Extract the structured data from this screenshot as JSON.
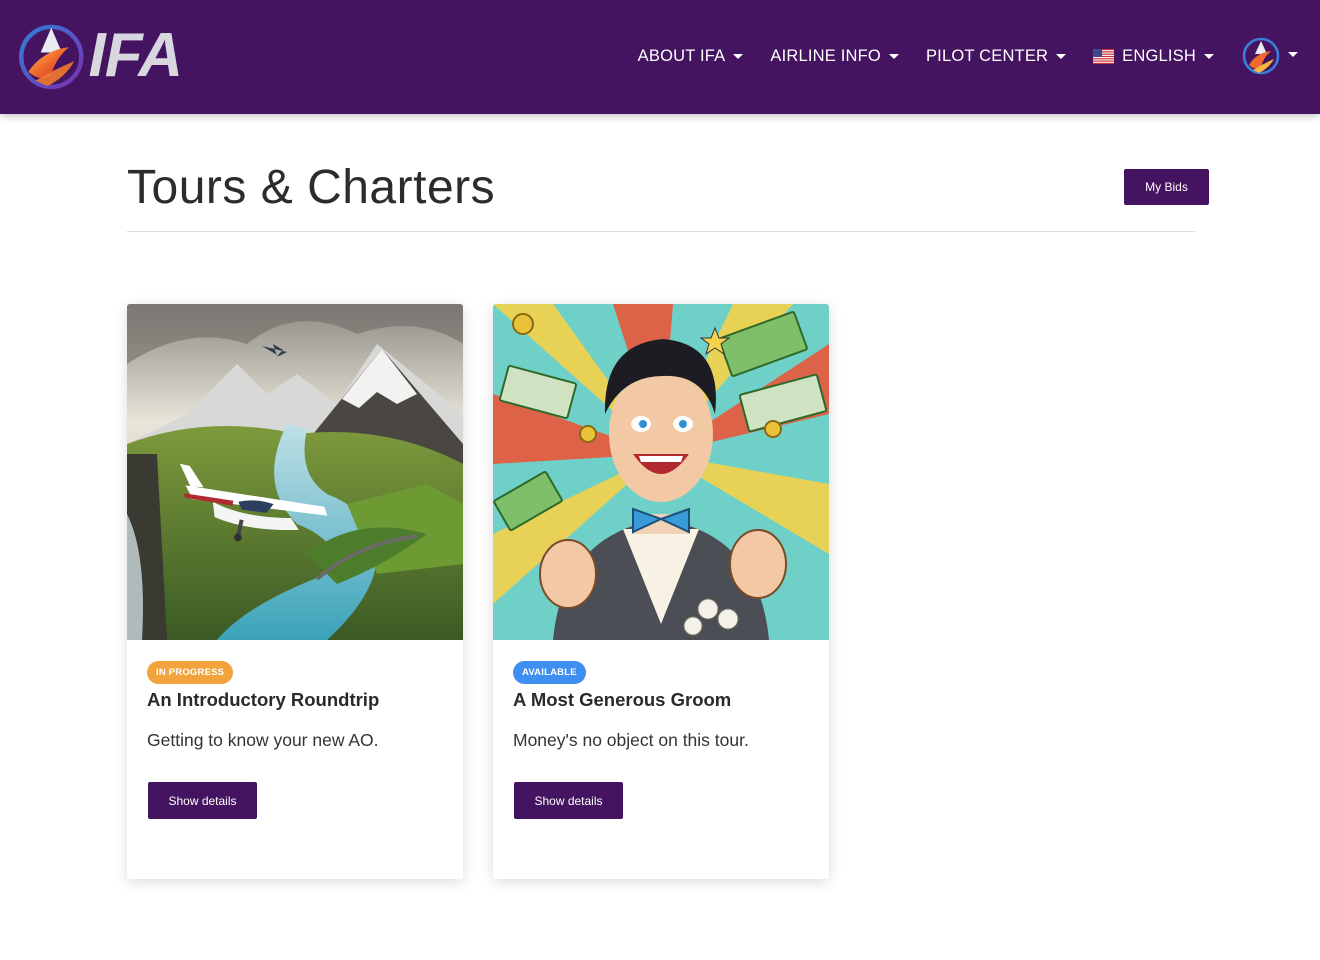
{
  "brand": {
    "logo_text": "IFA"
  },
  "nav": {
    "items": [
      {
        "label": "ABOUT IFA"
      },
      {
        "label": "AIRLINE INFO"
      },
      {
        "label": "PILOT CENTER"
      }
    ],
    "language": {
      "label": "ENGLISH",
      "flag": "us-flag-icon"
    }
  },
  "header": {
    "title": "Tours & Charters",
    "my_bids_label": "My Bids"
  },
  "cards": [
    {
      "status": "IN PROGRESS",
      "status_color": "#f2a33b",
      "title": "An Introductory Roundtrip",
      "description": "Getting to know your new AO.",
      "button_label": "Show details",
      "image": "mountain-river-plane-illustration"
    },
    {
      "status": "AVAILABLE",
      "status_color": "#3f8ff0",
      "title": "A Most Generous Groom",
      "description": "Money's no object on this tour.",
      "button_label": "Show details",
      "image": "pop-art-groom-money-illustration"
    }
  ],
  "colors": {
    "primary": "#451460",
    "in_progress": "#f2a33b",
    "available": "#3f8ff0"
  }
}
